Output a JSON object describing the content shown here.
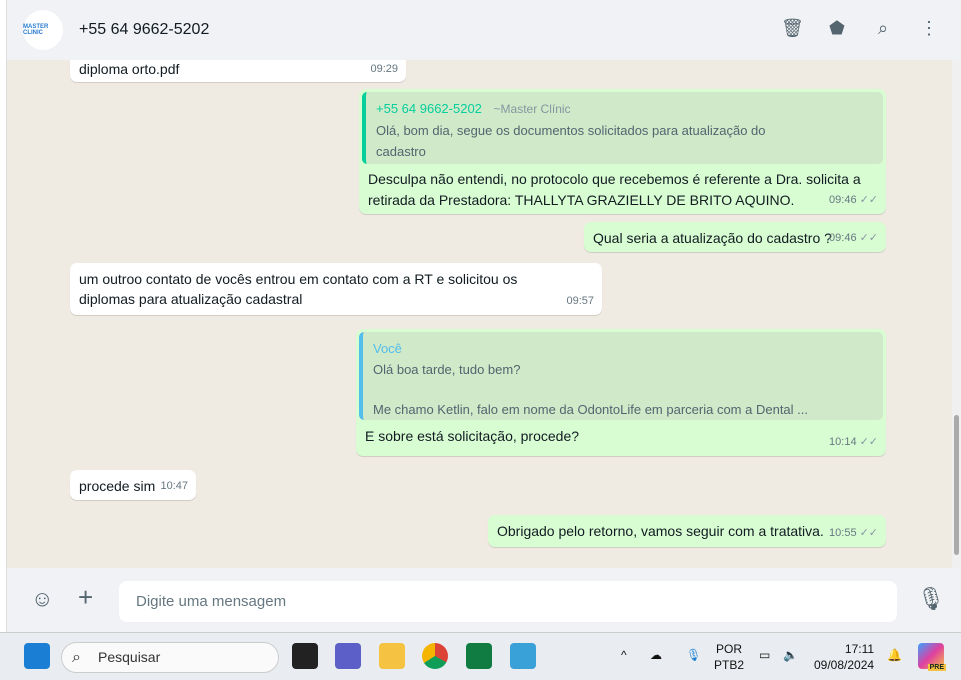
{
  "header": {
    "avatar_text": "MASTER CLINIC",
    "title": "+55 64 9662-5202"
  },
  "messages": [
    {
      "dir": "in",
      "text": "diploma orto.pdf",
      "time": "09:29"
    },
    {
      "dir": "out",
      "quote_name": "+55 64 9662-5202",
      "quote_sender": "~Master Clínic",
      "quote_text": "Olá, bom dia, segue os documentos solicitados para atualização do cadastro",
      "text": "Desculpa não entendi, no protocolo que recebemos é referente a Dra. solicita a retirada da Prestadora: THALLYTA GRAZIELLY DE BRITO AQUINO.",
      "time": "09:46"
    },
    {
      "dir": "out",
      "text": "Qual seria a atualização do cadastro ?",
      "time": "09:46"
    },
    {
      "dir": "in",
      "text": "um outroo contato de vocês entrou em contato com a RT e solicitou os diplomas para atualização cadastral",
      "time": "09:57"
    },
    {
      "dir": "out",
      "quote_name": "Você",
      "quote_text1": "Olá boa tarde, tudo bem?",
      "quote_text2": "Me chamo Ketlin, falo em nome da OdontoLife em parceria com a Dental ...",
      "text": "E sobre está solicitação, procede?",
      "time": "10:14"
    },
    {
      "dir": "in",
      "text": "procede sim",
      "time": "10:47"
    },
    {
      "dir": "out",
      "text": "Obrigado pelo retorno, vamos seguir com a tratativa.",
      "time": "10:55"
    }
  ],
  "footer": {
    "placeholder": "Digite uma mensagem"
  },
  "taskbar": {
    "search": "Pesquisar",
    "lang1": "POR",
    "lang2": "PTB2",
    "time": "17:11",
    "date": "09/08/2024",
    "copilot_badge": "PRE"
  },
  "colors": {
    "outgoing": "#d9fdd3",
    "incoming": "#ffffff",
    "chat_bg": "#efeae2",
    "quote_green": "#06cf9c",
    "quote_blue": "#53bdeb"
  }
}
